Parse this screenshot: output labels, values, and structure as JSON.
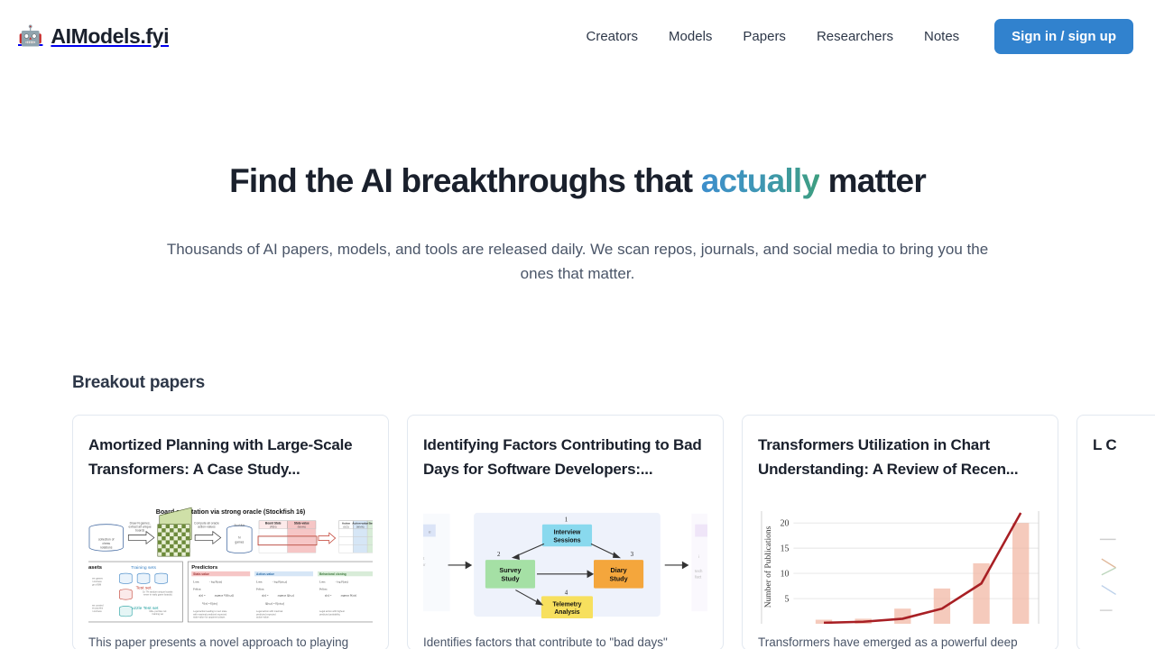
{
  "header": {
    "logo_emoji": "🤖",
    "brand": "AIModels.fyi",
    "nav": [
      {
        "label": "Creators"
      },
      {
        "label": "Models"
      },
      {
        "label": "Papers"
      },
      {
        "label": "Researchers"
      },
      {
        "label": "Notes"
      }
    ],
    "signin_label": "Sign in / sign up",
    "accent_color": "#3182ce"
  },
  "hero": {
    "title_part1": "Find the AI breakthroughs that ",
    "title_highlight": "actually",
    "title_part2": " matter",
    "highlight_gradient_from": "#3d8ecc",
    "highlight_gradient_to": "#3d9e80",
    "subtitle": "Thousands of AI papers, models, and tools are released daily. We scan repos, journals, and social media to bring you the ones that matter."
  },
  "section": {
    "title": "Breakout papers"
  },
  "cards": [
    {
      "title": "Amortized Planning with Large-Scale Transformers: A Case Study...",
      "description": "This paper presents a novel approach to playing",
      "thumbnail": {
        "kind": "chess-oracle-diagram",
        "heading": "Board annotation via strong oracle (Stockfish 16)",
        "labels": [
          "Draw N games,",
          "extract all unique",
          "boards",
          "Compute all oracle",
          "action-values",
          "collection of",
          "chess",
          "notations",
          "Stockfish",
          "N games",
          "Board State",
          "State-value",
          "Action",
          "Action-value",
          "Best Ac",
          "(FEN)",
          "(Win%)",
          "(UCI)",
          "(Win%)",
          "Datasets",
          "Training sets",
          "Test set",
          "Puzzle Test set",
          "Predictors",
          "State-value",
          "Action-value",
          "Behavioral cloning",
          "Loss:",
          "Policy:"
        ]
      }
    },
    {
      "title": "Identifying Factors Contributing to Bad Days for Software Developers:...",
      "description": "Identifies factors that contribute to \"bad days\"",
      "thumbnail": {
        "kind": "study-flow-diagram",
        "nodes": [
          {
            "num": "1",
            "label": "Interview Sessions",
            "color": "#89d9ee"
          },
          {
            "num": "2",
            "label": "Survey Study",
            "color": "#a5e0a5"
          },
          {
            "num": "3",
            "label": "Diary Study",
            "color": "#f4a63c"
          },
          {
            "num": "4",
            "label": "Telemetry Analysis",
            "color": "#f7e05e"
          }
        ],
        "side_labels": [
          "that",
          "s for",
          "ing",
          "tech",
          "fact"
        ]
      }
    },
    {
      "title": "Transformers Utilization in Chart Understanding: A Review of Recen...",
      "description": "Transformers have emerged as a powerful deep",
      "thumbnail": {
        "kind": "chart",
        "chart_ref": 0
      }
    },
    {
      "title": "L C",
      "description": "",
      "thumbnail": {
        "kind": "clipped"
      }
    }
  ],
  "chart_data": [
    {
      "type": "bar",
      "title": "",
      "xlabel": "",
      "ylabel": "Number of Publications",
      "categories": [
        "",
        "",
        "",
        "",
        "",
        ""
      ],
      "values": [
        0.8,
        1.0,
        3.0,
        7.0,
        12.0,
        20.0
      ],
      "ylim": [
        0,
        22
      ],
      "yticks": [
        5,
        10,
        15,
        20
      ],
      "grid": true,
      "bar_color": "#f2b8a6",
      "trend": {
        "name": "trend curve",
        "color": "#a81f24",
        "values": [
          0.2,
          0.4,
          1.0,
          3.0,
          8.0,
          22.0
        ]
      },
      "legend": "none"
    }
  ]
}
